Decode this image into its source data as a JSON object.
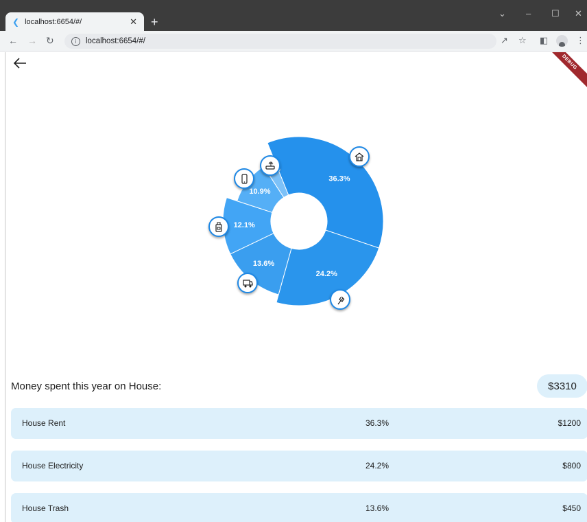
{
  "browser": {
    "tab_title": "localhost:6654/#/",
    "url": "localhost:6654/#/"
  },
  "debug_banner": "DEBUG",
  "chart_data": {
    "type": "pie",
    "donut": true,
    "colors": [
      "#2591ec",
      "#2a95ec",
      "#3a9eef",
      "#42a5f5",
      "#55aff6",
      "#7cc1f8"
    ],
    "slices": [
      {
        "label": "36.3%",
        "value": 36.3,
        "icon": "house-icon"
      },
      {
        "label": "24.2%",
        "value": 24.2,
        "icon": "electricity-plug-icon"
      },
      {
        "label": "13.6%",
        "value": 13.6,
        "icon": "trash-truck-icon"
      },
      {
        "label": "12.1%",
        "value": 12.1,
        "icon": "gas-can-icon"
      },
      {
        "label": "10.9%",
        "value": 10.9,
        "icon": "phone-icon"
      },
      {
        "label": "3.0%",
        "value": 3.0,
        "icon": "router-icon"
      }
    ]
  },
  "summary": {
    "label": "Money spent this year on House:",
    "total": "$3310"
  },
  "expenses": [
    {
      "name": "House Rent",
      "percent": "36.3%",
      "amount": "$1200"
    },
    {
      "name": "House Electricity",
      "percent": "24.2%",
      "amount": "$800"
    },
    {
      "name": "House Trash",
      "percent": "13.6%",
      "amount": "$450"
    }
  ]
}
